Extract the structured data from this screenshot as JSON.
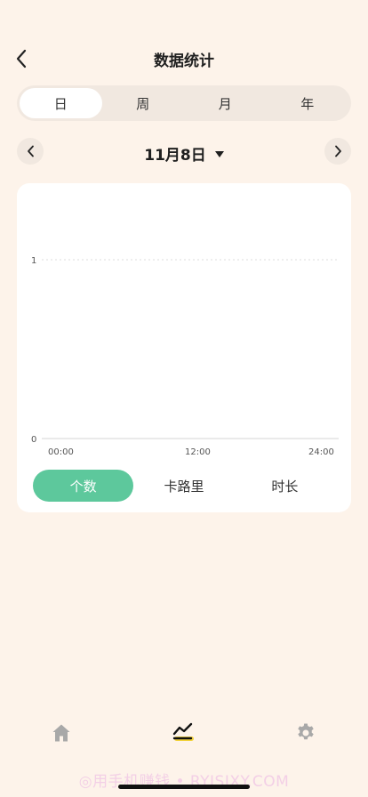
{
  "header": {
    "title": "数据统计"
  },
  "period_tabs": [
    {
      "label": "日",
      "active": true
    },
    {
      "label": "周",
      "active": false
    },
    {
      "label": "月",
      "active": false
    },
    {
      "label": "年",
      "active": false
    }
  ],
  "date": {
    "label": "11月8日"
  },
  "chart_data": {
    "type": "line",
    "x_ticks": [
      "00:00",
      "12:00",
      "24:00"
    ],
    "y_ticks": [
      "0",
      "1"
    ],
    "ylim": [
      0,
      1
    ],
    "series": [],
    "grid": true
  },
  "metric_tabs": [
    {
      "label": "个数",
      "active": true
    },
    {
      "label": "卡路里",
      "active": false
    },
    {
      "label": "时长",
      "active": false
    }
  ],
  "colors": {
    "accent": "#5dc89c",
    "background": "#fdf3ea",
    "nav_highlight": "#f2d23a",
    "icon_gray": "#a8a8a8"
  },
  "bottom_nav": [
    {
      "icon": "home-icon",
      "active": false
    },
    {
      "icon": "stats-icon",
      "active": true
    },
    {
      "icon": "gear-icon",
      "active": false
    }
  ],
  "watermark": "◎用手机赚钱 • RYISIXY.COM"
}
